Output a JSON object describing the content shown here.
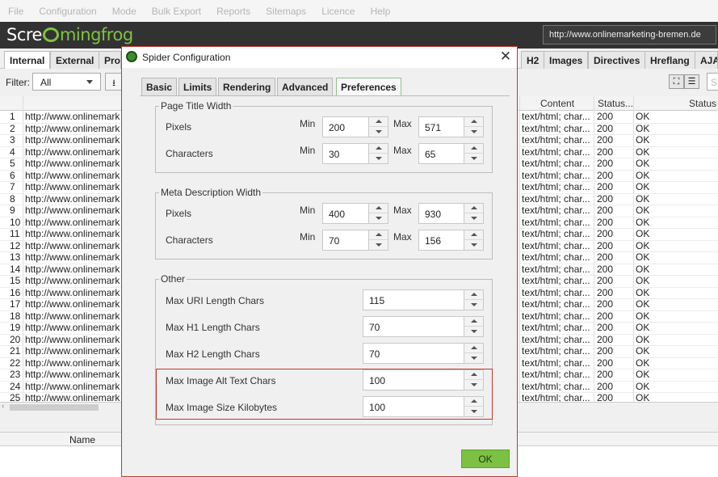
{
  "menu": [
    "File",
    "Configuration",
    "Mode",
    "Bulk Export",
    "Reports",
    "Sitemaps",
    "Licence",
    "Help"
  ],
  "logo": {
    "part1": "Scre",
    "part2": "mingfrog"
  },
  "url_bar": "http://www.onlinemarketing-bremen.de",
  "tabs": [
    "Internal",
    "External",
    "Pro",
    "H2",
    "Images",
    "Directives",
    "Hreflang",
    "AJA"
  ],
  "filter": {
    "label": "Filter:",
    "value": "All"
  },
  "search_placeholder": "S",
  "table": {
    "headers": {
      "content": "Content",
      "status_code": "Status...",
      "status": "Status"
    },
    "rows": [
      {
        "n": "1",
        "url": "http://www.onlinemark",
        "ct": "text/html; char...",
        "sc": "200",
        "st": "OK"
      },
      {
        "n": "2",
        "url": "http://www.onlinemark",
        "ct": "text/html; char...",
        "sc": "200",
        "st": "OK"
      },
      {
        "n": "3",
        "url": "http://www.onlinemark",
        "ct": "text/html; char...",
        "sc": "200",
        "st": "OK"
      },
      {
        "n": "4",
        "url": "http://www.onlinemark",
        "ct": "text/html; char...",
        "sc": "200",
        "st": "OK"
      },
      {
        "n": "5",
        "url": "http://www.onlinemark",
        "ct": "text/html; char...",
        "sc": "200",
        "st": "OK"
      },
      {
        "n": "6",
        "url": "http://www.onlinemark",
        "ct": "text/html; char...",
        "sc": "200",
        "st": "OK"
      },
      {
        "n": "7",
        "url": "http://www.onlinemark",
        "ct": "text/html; char...",
        "sc": "200",
        "st": "OK"
      },
      {
        "n": "8",
        "url": "http://www.onlinemark",
        "ct": "text/html; char...",
        "sc": "200",
        "st": "OK"
      },
      {
        "n": "9",
        "url": "http://www.onlinemark",
        "ct": "text/html; char...",
        "sc": "200",
        "st": "OK"
      },
      {
        "n": "10",
        "url": "http://www.onlinemark",
        "ct": "text/html; char...",
        "sc": "200",
        "st": "OK"
      },
      {
        "n": "11",
        "url": "http://www.onlinemark",
        "ct": "text/html; char...",
        "sc": "200",
        "st": "OK"
      },
      {
        "n": "12",
        "url": "http://www.onlinemark",
        "ct": "text/html; char...",
        "sc": "200",
        "st": "OK"
      },
      {
        "n": "13",
        "url": "http://www.onlinemark",
        "ct": "text/html; char...",
        "sc": "200",
        "st": "OK"
      },
      {
        "n": "14",
        "url": "http://www.onlinemark",
        "ct": "text/html; char...",
        "sc": "200",
        "st": "OK"
      },
      {
        "n": "15",
        "url": "http://www.onlinemark",
        "ct": "text/html; char...",
        "sc": "200",
        "st": "OK"
      },
      {
        "n": "16",
        "url": "http://www.onlinemark",
        "ct": "text/html; char...",
        "sc": "200",
        "st": "OK"
      },
      {
        "n": "17",
        "url": "http://www.onlinemark",
        "ct": "text/html; char...",
        "sc": "200",
        "st": "OK"
      },
      {
        "n": "18",
        "url": "http://www.onlinemark",
        "ct": "text/html; char...",
        "sc": "200",
        "st": "OK"
      },
      {
        "n": "19",
        "url": "http://www.onlinemark",
        "ct": "text/html; char...",
        "sc": "200",
        "st": "OK"
      },
      {
        "n": "20",
        "url": "http://www.onlinemark",
        "ct": "text/html; char...",
        "sc": "200",
        "st": "OK"
      },
      {
        "n": "21",
        "url": "http://www.onlinemark",
        "ct": "text/html; char...",
        "sc": "200",
        "st": "OK"
      },
      {
        "n": "22",
        "url": "http://www.onlinemark",
        "ct": "text/html; char...",
        "sc": "200",
        "st": "OK"
      },
      {
        "n": "23",
        "url": "http://www.onlinemark",
        "ct": "text/html; char...",
        "sc": "200",
        "st": "OK"
      },
      {
        "n": "24",
        "url": "http://www.onlinemark",
        "ct": "text/html; char...",
        "sc": "200",
        "st": "OK"
      },
      {
        "n": "25",
        "url": "http://www.onlinemark",
        "ct": "text/html; char...",
        "sc": "200",
        "st": "OK"
      }
    ]
  },
  "bottom_panel": {
    "name_header": "Name"
  },
  "dialog": {
    "title": "Spider Configuration",
    "tabs": [
      "Basic",
      "Limits",
      "Rendering",
      "Advanced",
      "Preferences"
    ],
    "page_title": {
      "legend": "Page Title Width",
      "pixels_label": "Pixels",
      "chars_label": "Characters",
      "min_label": "Min",
      "max_label": "Max",
      "pixels_min": "200",
      "pixels_max": "571",
      "chars_min": "30",
      "chars_max": "65"
    },
    "meta_desc": {
      "legend": "Meta Description Width",
      "pixels_label": "Pixels",
      "chars_label": "Characters",
      "min_label": "Min",
      "max_label": "Max",
      "pixels_min": "400",
      "pixels_max": "930",
      "chars_min": "70",
      "chars_max": "156"
    },
    "other": {
      "legend": "Other",
      "uri_label": "Max URI Length Chars",
      "uri_value": "115",
      "h1_label": "Max H1 Length Chars",
      "h1_value": "70",
      "h2_label": "Max H2 Length Chars",
      "h2_value": "70",
      "alt_label": "Max Image Alt Text Chars",
      "alt_value": "100",
      "img_label": "Max Image Size Kilobytes",
      "img_value": "100"
    },
    "ok_label": "OK"
  },
  "colors": {
    "accent": "#7cc144",
    "highlight": "#c0392b",
    "header_bg": "#323232"
  }
}
